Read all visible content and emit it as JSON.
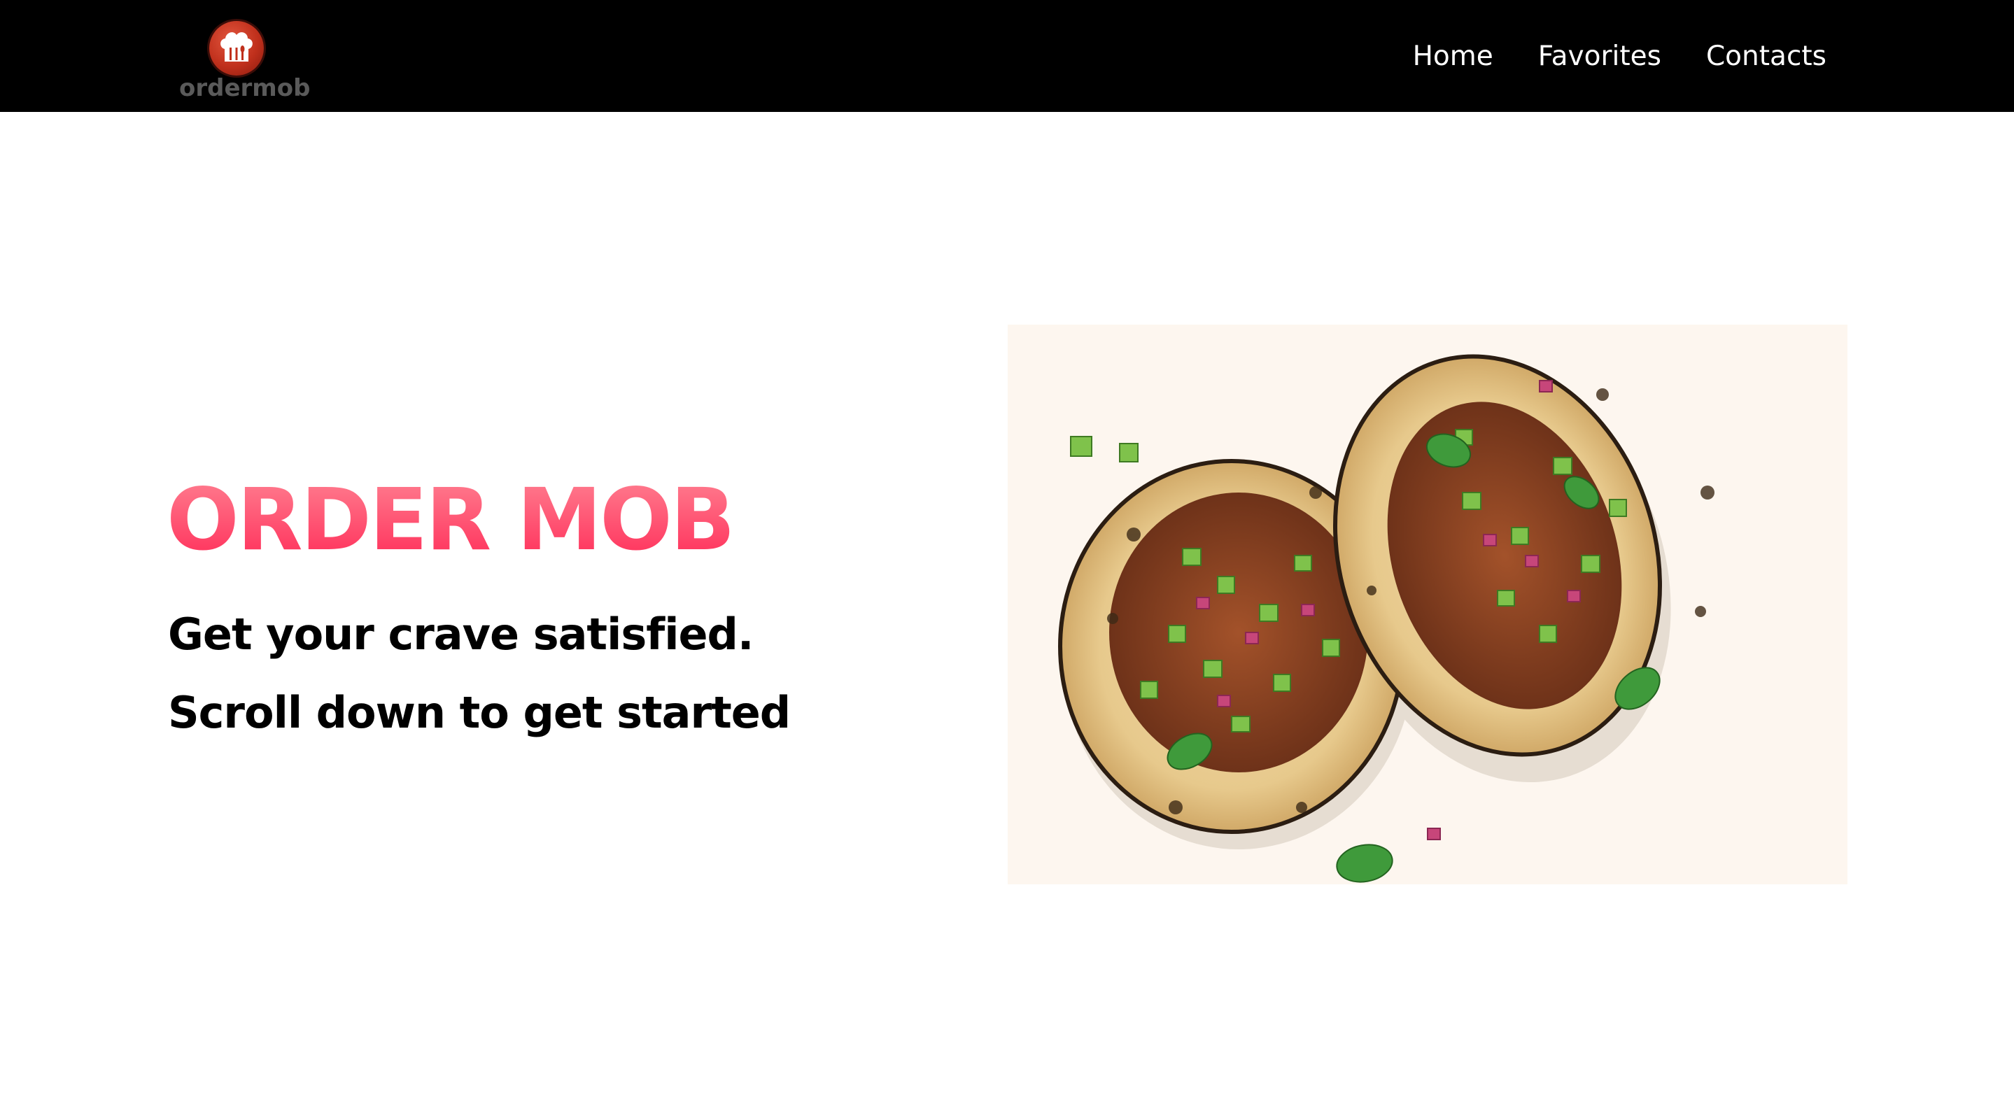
{
  "navbar": {
    "logo_text": "ordermob",
    "links": [
      {
        "label": "Home"
      },
      {
        "label": "Favorites"
      },
      {
        "label": "Contacts"
      }
    ]
  },
  "hero": {
    "title": "ORDER MOB",
    "subtitle_1": "Get your crave satisfied.",
    "subtitle_2": "Scroll down to get started",
    "image_subject": "two-tacos-photo"
  },
  "colors": {
    "navbar_bg": "#000000",
    "title_gradient_top": "#ff7d8f",
    "title_gradient_bottom": "#ff2f5a",
    "logo_red": "#c0301c",
    "image_bg": "#fdf6ef"
  }
}
